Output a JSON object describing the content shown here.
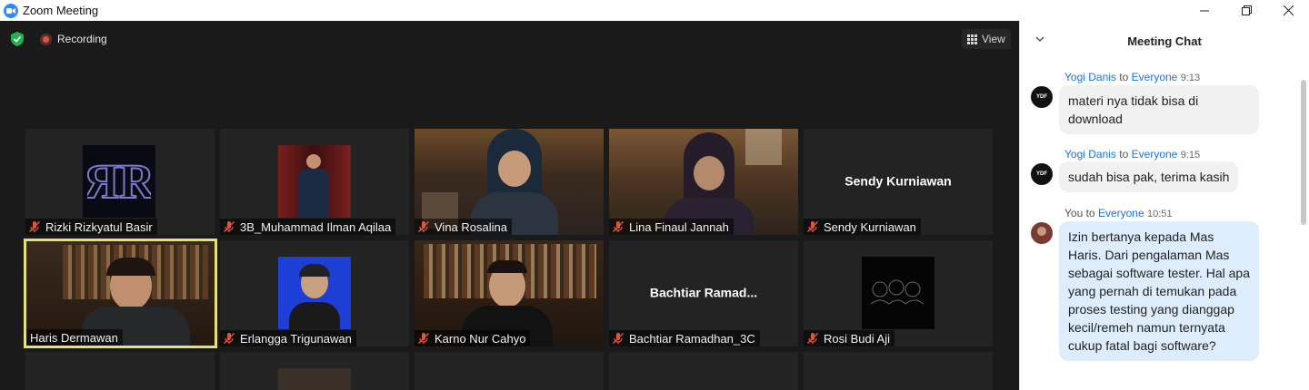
{
  "window": {
    "title": "Zoom Meeting",
    "controls": {
      "minimize": "—",
      "maximize": "❐",
      "close": "✕"
    }
  },
  "toolbar": {
    "recording_label": "Recording",
    "view_label": "View"
  },
  "participants": [
    {
      "name": "Rizki Rizkyatul Basir",
      "muted": true
    },
    {
      "name": "3B_Muhammad Ilman Aqilaa",
      "muted": true
    },
    {
      "name": "Vina Rosalina",
      "muted": true
    },
    {
      "name": "Lina Finaul Jannah",
      "muted": true
    },
    {
      "name": "Sendy Kurniawan",
      "muted": true,
      "display_name": "Sendy Kurniawan"
    },
    {
      "name": "Haris Dermawan",
      "muted": false,
      "active_speaker": true
    },
    {
      "name": "Erlangga Trigunawan",
      "muted": true
    },
    {
      "name": "Karno Nur Cahyo",
      "muted": true
    },
    {
      "name": "Bachtiar Ramadhan_3C",
      "muted": true,
      "display_name": "Bachtiar  Ramad..."
    },
    {
      "name": "Rosi Budi Aji",
      "muted": true
    }
  ],
  "chat": {
    "title": "Meeting Chat",
    "messages": [
      {
        "sender": "Yogi Danis",
        "to": "to",
        "recipient": "Everyone",
        "time": "9:13",
        "avatar": "YDF",
        "text": "materi nya tidak bisa di download"
      },
      {
        "sender": "Yogi Danis",
        "to": "to",
        "recipient": "Everyone",
        "time": "9:15",
        "avatar": "YDF",
        "text": "sudah bisa pak, terima kasih"
      },
      {
        "sender": "You",
        "to": "to",
        "recipient": "Everyone",
        "time": "10:51",
        "avatar": "",
        "text": "Izin bertanya kepada Mas Haris. Dari pengalaman Mas sebagai software tester. Hal apa yang pernah di temukan pada proses testing yang dianggap kecil/remeh namun ternyata cukup fatal bagi software?"
      }
    ]
  },
  "colors": {
    "accent": "#2d8cff",
    "active_speaker_border": "#e7e07a",
    "recording": "#e0533c",
    "link": "#1a73e8"
  }
}
